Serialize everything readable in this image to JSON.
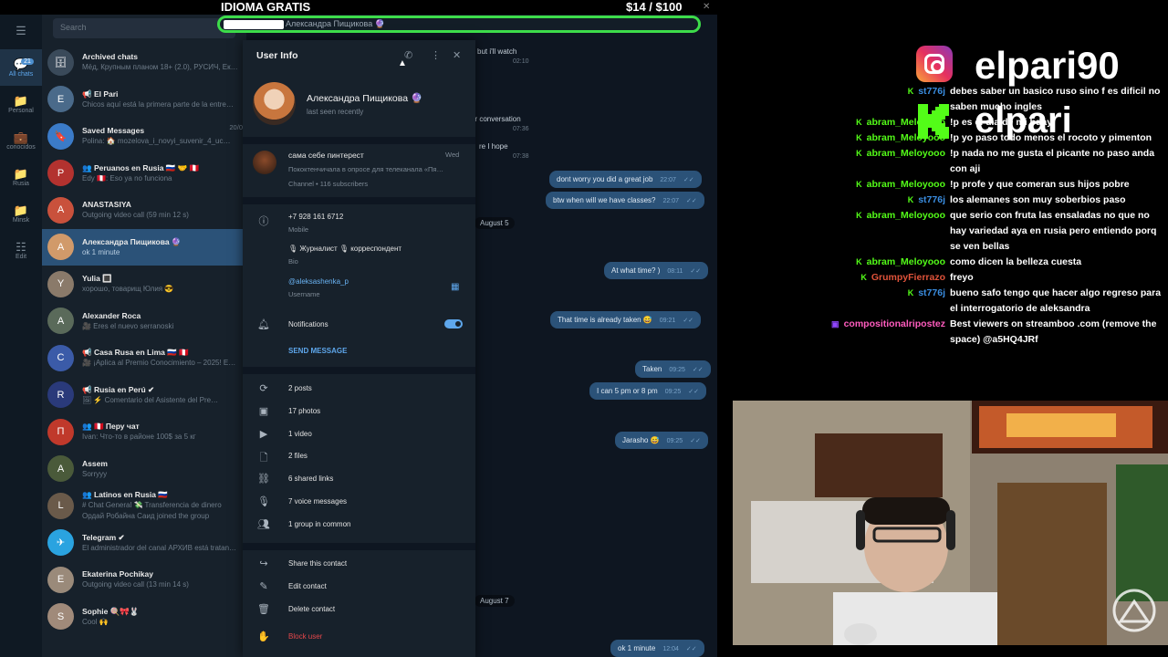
{
  "overlay": {
    "idioma": "IDIOMA GRATIS",
    "goal": "$14  /  $100",
    "bar_text": "Александра Пищикова 🔮"
  },
  "rail": [
    {
      "icon": "☰",
      "label": ""
    },
    {
      "icon": "💬",
      "label": "All chats",
      "badge": "21",
      "active": true
    },
    {
      "icon": "📁",
      "label": "Personal"
    },
    {
      "icon": "💼",
      "label": "conocidos"
    },
    {
      "icon": "📁",
      "label": "Rusia"
    },
    {
      "icon": "📁",
      "label": "Minsk"
    },
    {
      "icon": "☷",
      "label": "Edit"
    }
  ],
  "search_placeholder": "Search",
  "chats": [
    {
      "name": "Archived chats",
      "msg": "Мёд, Крупным планом 18+ (2.0), РУСИЧ, Ек…",
      "time": "",
      "color": "#3a4a5a",
      "initial": "🗄"
    },
    {
      "name": "📢 El Pari",
      "msg": "Chicos aquí está la primera parte de la entre…",
      "time": "",
      "color": "#4a6a8a",
      "initial": "E"
    },
    {
      "name": "Saved Messages",
      "msg": "Polina: 🏠 mozelova_i_novyi_suvenir_4_uc…",
      "time": "20/0",
      "color": "#3b7bc8",
      "initial": "🔖"
    },
    {
      "name": "👥 Peruanos en Rusia 🇷🇺 🤝 🇵🇪",
      "msg": "Edy 🇵🇪: Eso ya no funciona",
      "time": "",
      "color": "#b3322f",
      "initial": "P"
    },
    {
      "name": "ANASTASIYA",
      "msg": "Outgoing video call (59 min 12 s)",
      "time": "",
      "color": "#c9513c",
      "initial": "A"
    },
    {
      "name": "Александра Пищикова 🔮",
      "msg": "ok 1 minute",
      "time": "",
      "color": "#d19a6a",
      "initial": "А",
      "active": true
    },
    {
      "name": "Yulia 🔳",
      "msg": "хорошо, товарищ Юлия 😎",
      "time": "",
      "color": "#8a7a6a",
      "initial": "Y"
    },
    {
      "name": "Alexander Roca",
      "msg": "🎥 Eres el nuevo serranoski",
      "time": "",
      "color": "#5a6a5a",
      "initial": "A"
    },
    {
      "name": "📢 Casa Rusa en Lima 🇷🇺 🇵🇪",
      "msg": "🎥 ¡Aplica al Premio Conocimiento – 2025! E…",
      "time": "",
      "color": "#3b5ba8",
      "initial": "C"
    },
    {
      "name": "📢 Rusia en Perú ✔",
      "msg": "🖼 ⚡ Comentario del Asistente del Pre…",
      "time": "",
      "color": "#2a3a7a",
      "initial": "R"
    },
    {
      "name": "👥 🇵🇪 Перу чат",
      "msg": "Ivan: Что-то в районе 100$ за 5 кг",
      "time": "",
      "color": "#c0392b",
      "initial": "П"
    },
    {
      "name": "Assem",
      "msg": "Sorryyy",
      "time": "",
      "color": "#4a5a3a",
      "initial": "A"
    },
    {
      "name": "👥 Latinos en Rusia 🇷🇺",
      "msg": "# Chat General 💸 Transferencia de dinero",
      "msg2": "Ордай Робайна Саид joined the group",
      "time": "",
      "color": "#6a5a4a",
      "initial": "L"
    },
    {
      "name": "Telegram ✔",
      "msg": "El administrador del canal АРХИВ está tratan…",
      "time": "",
      "color": "#2aa3e0",
      "initial": "✈"
    },
    {
      "name": "Ekaterina Pochikay",
      "msg": "Outgoing video call (13 min 14 s)",
      "time": "",
      "color": "#9a8a7a",
      "initial": "E"
    },
    {
      "name": "Sophie 🍭🎀🐰",
      "msg": "Cool 🙌",
      "time": "",
      "color": "#a08a7a",
      "initial": "S"
    }
  ],
  "conversation": {
    "incoming_top": [
      "but i'll watch",
      "ur conversation",
      "re I hope"
    ],
    "incoming_times": [
      "02:10",
      "07:36",
      "07:38"
    ],
    "dates": [
      "August 5",
      "August 7"
    ],
    "outgoing": [
      {
        "text": "dont worry you did a great job",
        "time": "22:07"
      },
      {
        "text": "btw when will we have classes?",
        "time": "22:07"
      },
      {
        "text": "At what time? )",
        "time": "08:11"
      },
      {
        "text": "That time is already taken 😅",
        "time": "09:21"
      },
      {
        "text": "Taken",
        "time": "09:25"
      },
      {
        "text": "I can 5 pm or 8 pm",
        "time": "09:25"
      },
      {
        "text": "Jarasho 😅",
        "time": "09:25"
      },
      {
        "text": "ok 1 minute",
        "time": "12:04"
      }
    ]
  },
  "user_info": {
    "title": "User Info",
    "name": "Александра Пищикова 🔮",
    "status": "last seen recently",
    "channel": {
      "name": "сама себе пинтерест",
      "time": "Wed",
      "desc": "Пококтенчичала в опросе для телеканала «Пя…",
      "meta": "Channel • 116 subscribers"
    },
    "phone": "+7 928 161 6712",
    "phone_label": "Mobile",
    "bio": "🎙 Журналист 🎙 корреспондент",
    "bio_label": "Bio",
    "username": "@aleksashenka_p",
    "username_label": "Username",
    "notifications": "Notifications",
    "send_message": "SEND MESSAGE",
    "media": [
      "2 posts",
      "17 photos",
      "1 video",
      "2 files",
      "6 shared links",
      "7 voice messages",
      "1 group in common"
    ],
    "actions": [
      "Share this contact",
      "Edit contact",
      "Delete contact"
    ],
    "block": "Block user",
    "accent": "#5ea7ec",
    "danger": "#e5474b"
  },
  "stream": {
    "instagram": "elpari90",
    "kick": "elpari",
    "chat": [
      {
        "user": "st776j",
        "color": "#3a8de0",
        "text": "debes saber un basico ruso sino f es dificil no saben mucho ingles"
      },
      {
        "user": "abram_Meloyooo",
        "color": "#53fc18",
        "text": "!p es el dia de mi bday"
      },
      {
        "user": "abram_Meloyooo",
        "color": "#53fc18",
        "text": "!p yo paso todo menos el rocoto y pimenton"
      },
      {
        "user": "abram_Meloyooo",
        "color": "#53fc18",
        "text": "!p nada no me gusta el picante no paso anda con aji"
      },
      {
        "user": "abram_Meloyooo",
        "color": "#53fc18",
        "text": "!p profe y que comeran sus hijos pobre"
      },
      {
        "user": "st776j",
        "color": "#3a8de0",
        "text": "los alemanes son muy soberbios paso"
      },
      {
        "user": "abram_Meloyooo",
        "color": "#53fc18",
        "text": "que serio con fruta las ensaladas no que no hay variedad aya en rusia pero entiendo porq se ven bellas"
      },
      {
        "user": "abram_Meloyooo",
        "color": "#53fc18",
        "text": "como dicen la belleza cuesta"
      },
      {
        "user": "GrumpyFierrazo",
        "color": "#e0533a",
        "text": "freyo"
      },
      {
        "user": "st776j",
        "color": "#3a8de0",
        "text": "bueno safo tengo que hacer algo regreso para el interrogatorio de aleksandra"
      },
      {
        "user": "compositionalripostez",
        "color": "#ff5cbe",
        "platform": "twitch",
        "text": "Best viewers on streamboo .com (remove the space) @a5HQ4JRf"
      }
    ]
  }
}
